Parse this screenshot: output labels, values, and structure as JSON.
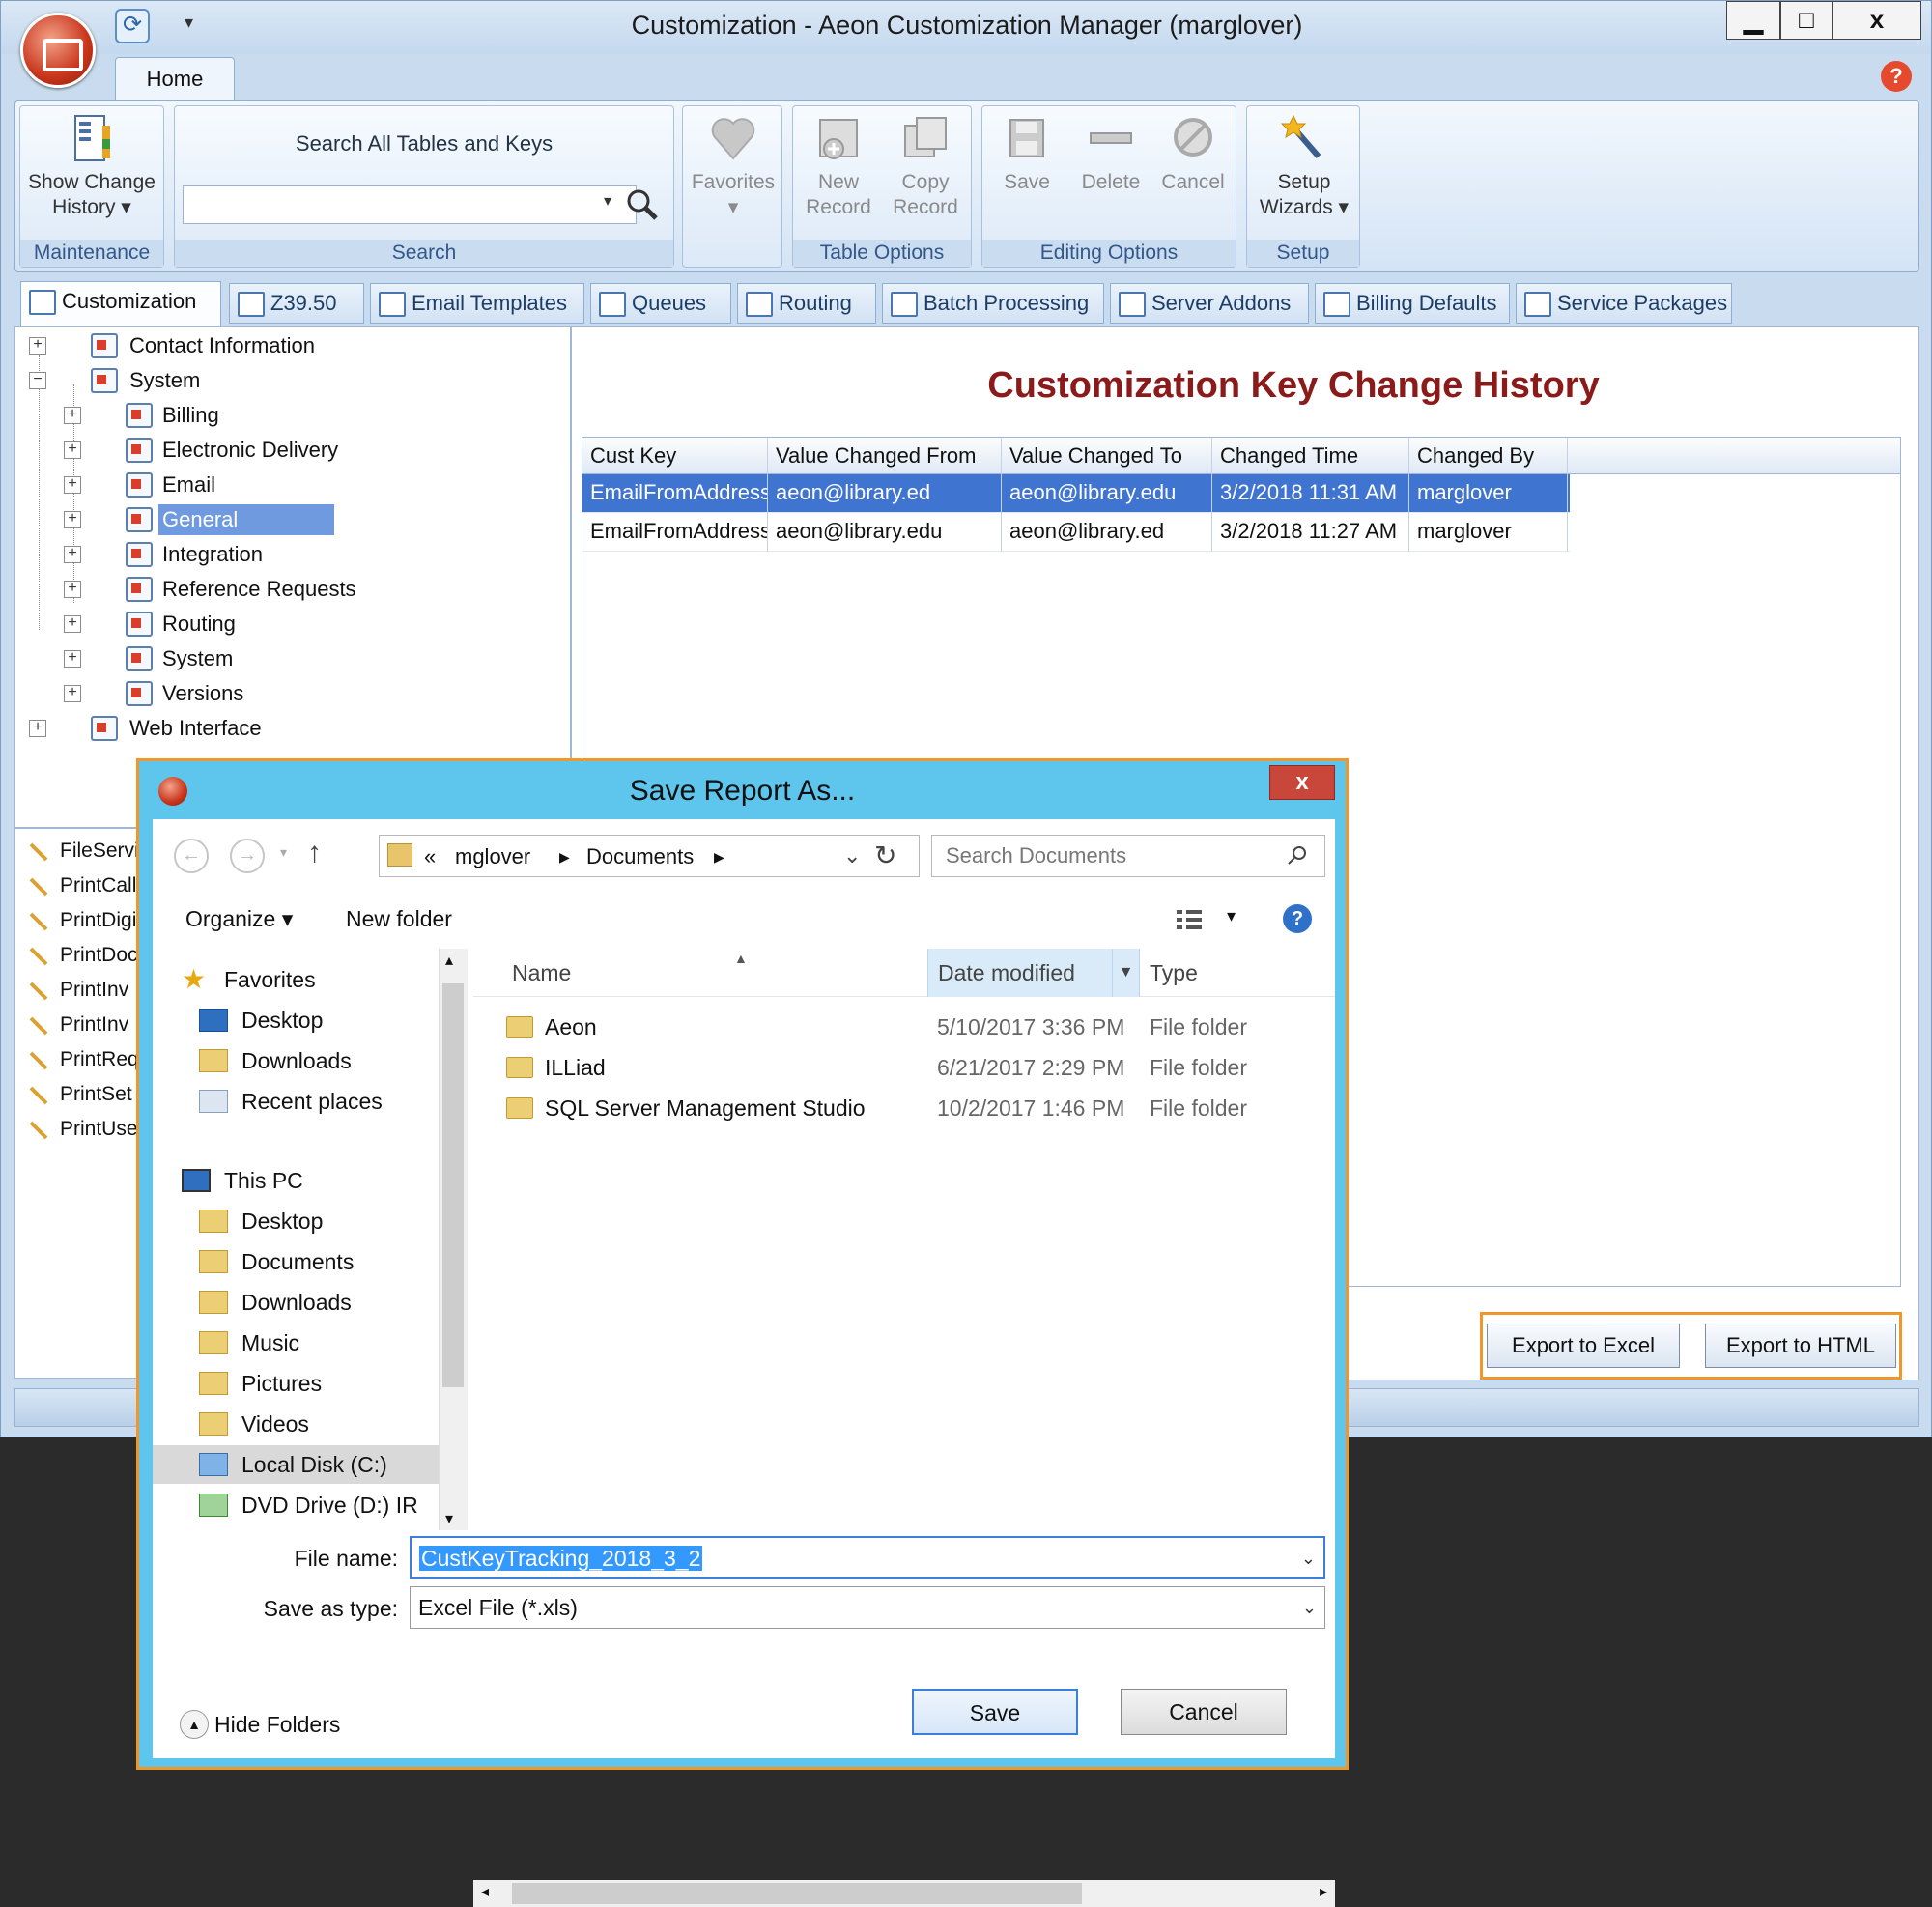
{
  "window": {
    "title": "Customization - Aeon Customization Manager (marglover)"
  },
  "ribbon": {
    "tab": "Home",
    "groups": {
      "maintenance": {
        "label": "Maintenance",
        "show_change_history": "Show Change",
        "show_change_history_2": "History"
      },
      "search": {
        "label": "Search",
        "heading": "Search All Tables and Keys",
        "value": ""
      },
      "favorites": {
        "label": "Favorites"
      },
      "table_options": {
        "label": "Table Options",
        "new_record_1": "New",
        "new_record_2": "Record",
        "copy_record_1": "Copy",
        "copy_record_2": "Record"
      },
      "editing_options": {
        "label": "Editing Options",
        "save": "Save",
        "delete": "Delete",
        "cancel": "Cancel"
      },
      "setup": {
        "label": "Setup",
        "wizards_1": "Setup",
        "wizards_2": "Wizards"
      }
    }
  },
  "tabs": [
    "Customization",
    "Z39.50",
    "Email Templates",
    "Queues",
    "Routing",
    "Batch Processing",
    "Server Addons",
    "Billing Defaults",
    "Service Packages"
  ],
  "tree": {
    "contact_information": "Contact Information",
    "system": "System",
    "children": [
      "Billing",
      "Electronic Delivery",
      "Email",
      "General",
      "Integration",
      "Reference Requests",
      "Routing",
      "System",
      "Versions"
    ],
    "selected": "General",
    "web_interface": "Web Interface"
  },
  "key_list": [
    "FileServi",
    "PrintCall",
    "PrintDigi",
    "PrintDoc",
    "PrintInv",
    "PrintInv",
    "PrintReq",
    "PrintSet",
    "PrintUse"
  ],
  "history": {
    "title": "Customization Key Change History",
    "columns": [
      "Cust Key",
      "Value Changed From",
      "Value Changed To",
      "Changed Time",
      "Changed By"
    ],
    "rows": [
      [
        "EmailFromAddress",
        "aeon@library.ed",
        "aeon@library.edu",
        "3/2/2018 11:31 AM",
        "marglover"
      ],
      [
        "EmailFromAddress",
        "aeon@library.edu",
        "aeon@library.ed",
        "3/2/2018 11:27 AM",
        "marglover"
      ]
    ],
    "export_excel": "Export to Excel",
    "export_html": "Export to HTML"
  },
  "dialog": {
    "title": "Save Report As...",
    "close": "x",
    "address": {
      "prefix": "«",
      "part1": "mglover",
      "part2": "Documents"
    },
    "search_placeholder": "Search Documents",
    "organize": "Organize",
    "new_folder": "New folder",
    "nav": {
      "favorites": "Favorites",
      "fav_items": [
        "Desktop",
        "Downloads",
        "Recent places"
      ],
      "this_pc": "This PC",
      "pc_items": [
        "Desktop",
        "Documents",
        "Downloads",
        "Music",
        "Pictures",
        "Videos",
        "Local Disk (C:)",
        "DVD Drive (D:) IR"
      ]
    },
    "columns": {
      "name": "Name",
      "date": "Date modified",
      "type": "Type"
    },
    "files": [
      {
        "name": "Aeon",
        "date": "5/10/2017 3:36 PM",
        "type": "File folder"
      },
      {
        "name": "ILLiad",
        "date": "6/21/2017 2:29 PM",
        "type": "File folder"
      },
      {
        "name": "SQL Server Management Studio",
        "date": "10/2/2017 1:46 PM",
        "type": "File folder"
      }
    ],
    "file_name_label": "File name:",
    "file_name": "CustKeyTracking_2018_3_2",
    "save_type_label": "Save as type:",
    "save_type": "Excel File (*.xls)",
    "hide_folders": "Hide Folders",
    "save": "Save",
    "cancel": "Cancel"
  }
}
